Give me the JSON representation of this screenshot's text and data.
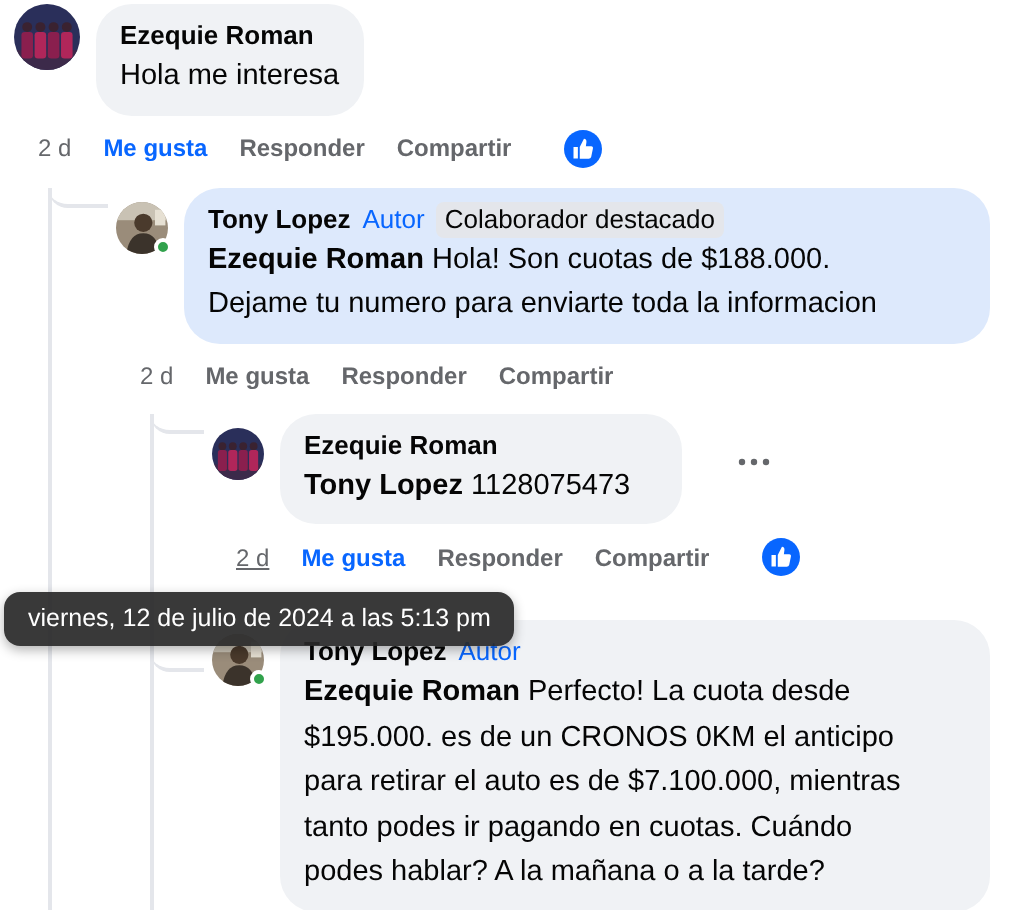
{
  "comments": [
    {
      "author": "Ezequie Roman",
      "text": "Hola me interesa",
      "time": "2 d",
      "time_hovered": false,
      "like_label": "Me gusta",
      "liked": true,
      "reply_label": "Responder",
      "share_label": "Compartir",
      "like_reaction": true,
      "children": [
        {
          "author": "Tony Lopez",
          "online": true,
          "highlighted": true,
          "badges": [
            {
              "label": "Autor",
              "kind": "role"
            },
            {
              "label": "Colaborador destacado",
              "kind": "tag"
            }
          ],
          "mention": "Ezequie Roman",
          "text": "Hola! Son cuotas de $188.000. Dejame tu numero para enviarte toda la informacion",
          "time": "2 d",
          "time_hovered": false,
          "like_label": "Me gusta",
          "liked": false,
          "reply_label": "Responder",
          "share_label": "Compartir",
          "children": [
            {
              "author": "Ezequie Roman",
              "mention": "Tony Lopez",
              "text": "1128075473",
              "time": "2 d",
              "time_hovered": true,
              "tooltip": "viernes, 12 de julio de 2024 a las 5:13 pm",
              "like_label": "Me gusta",
              "liked": true,
              "reply_label": "Responder",
              "share_label": "Compartir",
              "like_reaction": true,
              "more_menu": true
            },
            {
              "author": "Tony Lopez",
              "online": true,
              "badges": [
                {
                  "label": "Autor",
                  "kind": "role"
                }
              ],
              "mention": "Ezequie Roman",
              "text": "Perfecto! La cuota desde $195.000. es de un CRONOS 0KM el anticipo para retirar el auto es de $7.100.000, mientras tanto podes ir pagando en cuotas. Cuándo podes hablar? A la mañana o a la tarde?"
            }
          ]
        }
      ]
    }
  ]
}
